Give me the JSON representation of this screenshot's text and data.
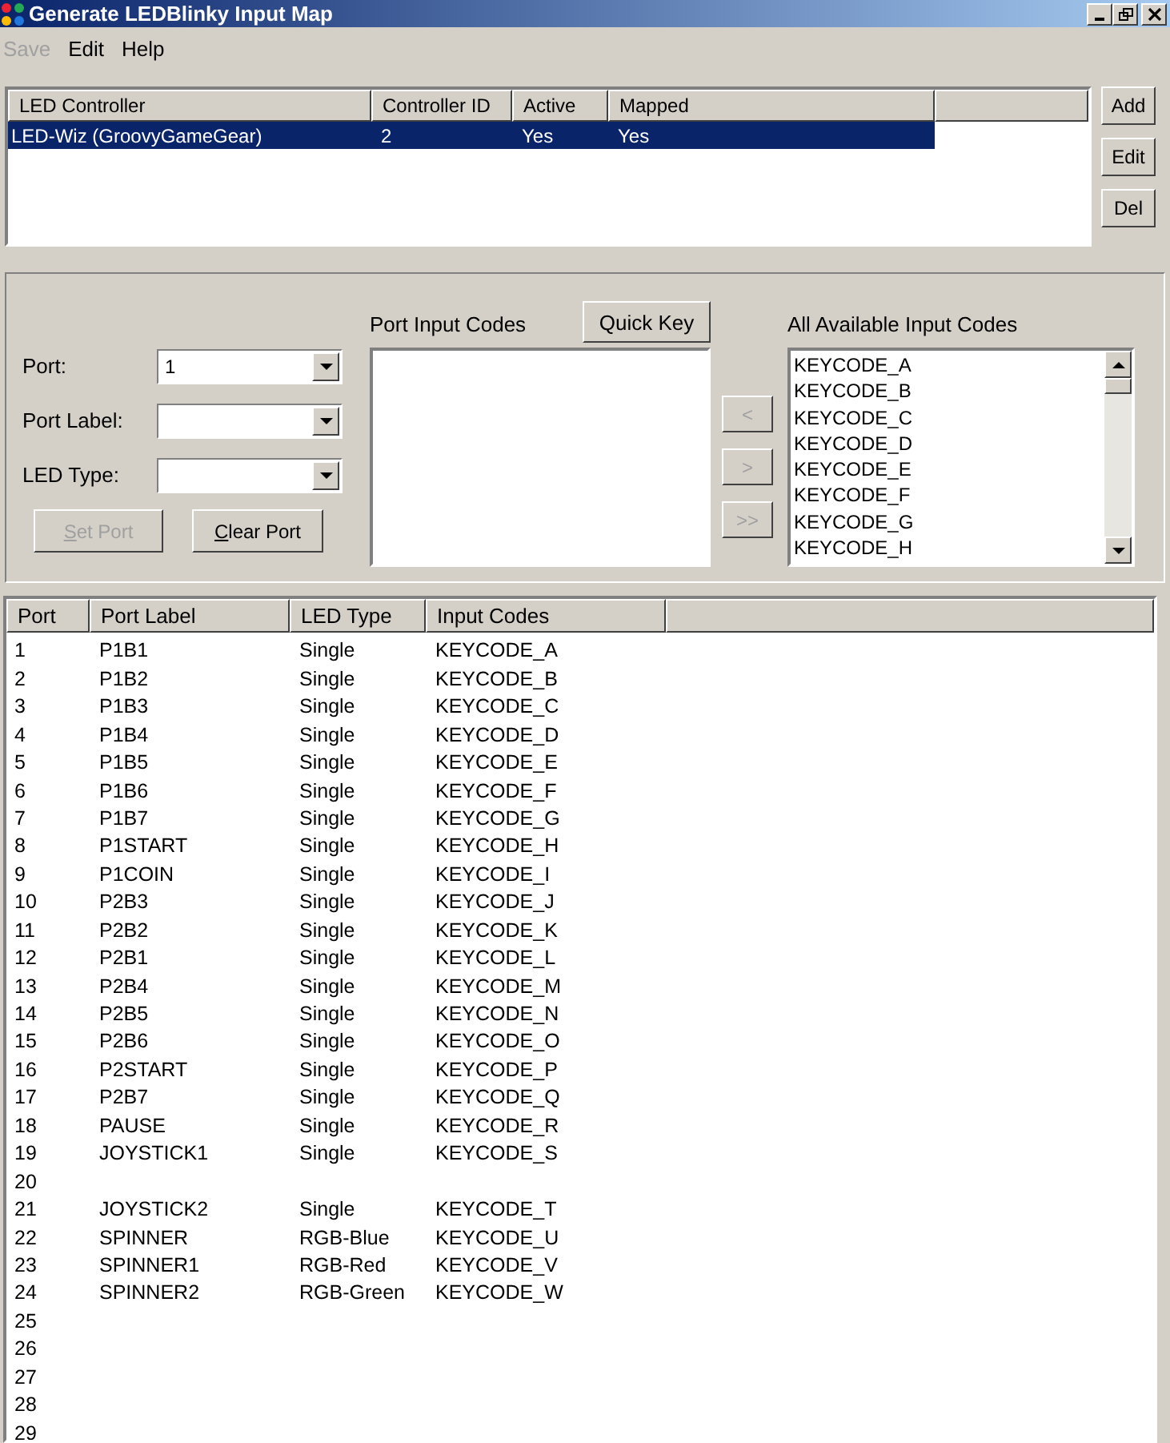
{
  "window": {
    "title": "Generate LEDBlinky Input Map"
  },
  "menu": [
    {
      "label": "Save",
      "disabled": true
    },
    {
      "label": "Edit",
      "disabled": false
    },
    {
      "label": "Help",
      "disabled": false
    }
  ],
  "controllers": {
    "columns": [
      "LED Controller",
      "Controller ID",
      "Active",
      "Mapped"
    ],
    "rows": [
      {
        "cells": [
          "LED-Wiz (GroovyGameGear)",
          "2",
          "Yes",
          "Yes"
        ],
        "selected": true
      }
    ]
  },
  "controller_buttons": [
    "Add",
    "Edit",
    "Del"
  ],
  "port_editor": {
    "port_label": "Port:",
    "port_value": "1",
    "port_label_label": "Port Label:",
    "led_type_label": "LED Type:",
    "set_port": {
      "label": "Set Port",
      "disabled": true
    },
    "clear_port": {
      "label": "Clear Port",
      "disabled": false
    },
    "port_input_codes_label": "Port Input Codes",
    "quick_key": "Quick Key",
    "move_buttons": [
      {
        "label": "<",
        "disabled": true
      },
      {
        "label": ">",
        "disabled": true
      },
      {
        "label": ">>",
        "disabled": true
      }
    ],
    "all_codes_label": "All Available Input Codes",
    "all_codes": [
      "KEYCODE_A",
      "KEYCODE_B",
      "KEYCODE_C",
      "KEYCODE_D",
      "KEYCODE_E",
      "KEYCODE_F",
      "KEYCODE_G",
      "KEYCODE_H"
    ]
  },
  "ports": {
    "columns": [
      "Port",
      "Port Label",
      "LED Type",
      "Input Codes"
    ],
    "rows": [
      [
        "1",
        "P1B1",
        "Single",
        "KEYCODE_A"
      ],
      [
        "2",
        "P1B2",
        "Single",
        "KEYCODE_B"
      ],
      [
        "3",
        "P1B3",
        "Single",
        "KEYCODE_C"
      ],
      [
        "4",
        "P1B4",
        "Single",
        "KEYCODE_D"
      ],
      [
        "5",
        "P1B5",
        "Single",
        "KEYCODE_E"
      ],
      [
        "6",
        "P1B6",
        "Single",
        "KEYCODE_F"
      ],
      [
        "7",
        "P1B7",
        "Single",
        "KEYCODE_G"
      ],
      [
        "8",
        "P1START",
        "Single",
        "KEYCODE_H"
      ],
      [
        "9",
        "P1COIN",
        "Single",
        "KEYCODE_I"
      ],
      [
        "10",
        "P2B3",
        "Single",
        "KEYCODE_J"
      ],
      [
        "11",
        "P2B2",
        "Single",
        "KEYCODE_K"
      ],
      [
        "12",
        "P2B1",
        "Single",
        "KEYCODE_L"
      ],
      [
        "13",
        "P2B4",
        "Single",
        "KEYCODE_M"
      ],
      [
        "14",
        "P2B5",
        "Single",
        "KEYCODE_N"
      ],
      [
        "15",
        "P2B6",
        "Single",
        "KEYCODE_O"
      ],
      [
        "16",
        "P2START",
        "Single",
        "KEYCODE_P"
      ],
      [
        "17",
        "P2B7",
        "Single",
        "KEYCODE_Q"
      ],
      [
        "18",
        "PAUSE",
        "Single",
        "KEYCODE_R"
      ],
      [
        "19",
        "JOYSTICK1",
        "Single",
        "KEYCODE_S"
      ],
      [
        "20"
      ],
      [
        "21",
        "JOYSTICK2",
        "Single",
        "KEYCODE_T"
      ],
      [
        "22",
        "SPINNER",
        "RGB-Blue",
        "KEYCODE_U"
      ],
      [
        "23",
        "SPINNER1",
        "RGB-Red",
        "KEYCODE_V"
      ],
      [
        "24",
        "SPINNER2",
        "RGB-Green",
        "KEYCODE_W"
      ],
      [
        "25"
      ],
      [
        "26"
      ],
      [
        "27"
      ],
      [
        "28"
      ],
      [
        "29"
      ]
    ]
  }
}
